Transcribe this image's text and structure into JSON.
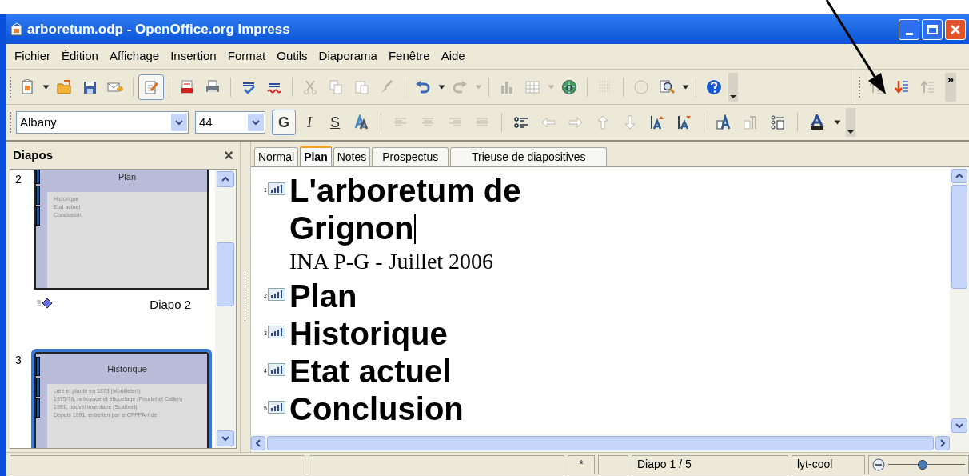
{
  "window": {
    "title": "arboretum.odp - OpenOffice.org Impress"
  },
  "menu": [
    "Fichier",
    "Édition",
    "Affichage",
    "Insertion",
    "Format",
    "Outils",
    "Diaporama",
    "Fenêtre",
    "Aide"
  ],
  "standard_toolbar": [
    {
      "kind": "new",
      "disabled": false
    },
    {
      "kind": "caret",
      "disabled": false
    },
    {
      "kind": "open",
      "disabled": false
    },
    {
      "kind": "save",
      "disabled": false
    },
    {
      "kind": "mail",
      "disabled": false
    },
    {
      "kind": "sep",
      "disabled": false
    },
    {
      "kind": "edit",
      "disabled": false
    },
    {
      "kind": "sep",
      "disabled": false
    },
    {
      "kind": "pdf",
      "disabled": false
    },
    {
      "kind": "print",
      "disabled": false
    },
    {
      "kind": "sep",
      "disabled": false
    },
    {
      "kind": "spell",
      "disabled": false
    },
    {
      "kind": "autospell",
      "disabled": false
    },
    {
      "kind": "sep",
      "disabled": false
    },
    {
      "kind": "cut",
      "disabled": true
    },
    {
      "kind": "copy",
      "disabled": true
    },
    {
      "kind": "paste",
      "disabled": true
    },
    {
      "kind": "brush",
      "disabled": true
    },
    {
      "kind": "sep",
      "disabled": false
    },
    {
      "kind": "undo",
      "disabled": false
    },
    {
      "kind": "caret",
      "disabled": false
    },
    {
      "kind": "redo",
      "disabled": true
    },
    {
      "kind": "caret",
      "disabled": true
    },
    {
      "kind": "sep",
      "disabled": false
    },
    {
      "kind": "chart",
      "disabled": true
    },
    {
      "kind": "table",
      "disabled": true
    },
    {
      "kind": "caret",
      "disabled": true
    },
    {
      "kind": "globe",
      "disabled": false
    },
    {
      "kind": "sep",
      "disabled": false
    },
    {
      "kind": "grid",
      "disabled": true
    },
    {
      "kind": "sep",
      "disabled": false
    },
    {
      "kind": "compass",
      "disabled": true
    },
    {
      "kind": "zoom",
      "disabled": false
    },
    {
      "kind": "caret",
      "disabled": false
    },
    {
      "kind": "sep",
      "disabled": false
    },
    {
      "kind": "help",
      "disabled": false
    }
  ],
  "outline_toolbar": {
    "buttons": [
      {
        "kind": "promote",
        "disabled": true
      },
      {
        "kind": "demote",
        "disabled": false
      },
      {
        "kind": "moveup",
        "disabled": true
      }
    ],
    "overflow": "»"
  },
  "format_toolbar": {
    "font": "Albany",
    "size": "44",
    "text_buttons": [
      {
        "kind": "bold",
        "text": "G",
        "selected": true
      },
      {
        "kind": "italic",
        "text": "I",
        "selected": false
      },
      {
        "kind": "underline",
        "text": "S",
        "selected": false
      }
    ],
    "icons": [
      {
        "kind": "shadow",
        "disabled": false
      },
      {
        "kind": "sep",
        "disabled": false
      },
      {
        "kind": "alignleft",
        "disabled": true
      },
      {
        "kind": "aligncenter",
        "disabled": true
      },
      {
        "kind": "alignright",
        "disabled": true
      },
      {
        "kind": "justify",
        "disabled": true
      },
      {
        "kind": "sep",
        "disabled": false
      },
      {
        "kind": "bullets",
        "disabled": false
      },
      {
        "kind": "left",
        "disabled": true
      },
      {
        "kind": "right",
        "disabled": true
      },
      {
        "kind": "up",
        "disabled": true
      },
      {
        "kind": "down",
        "disabled": true
      },
      {
        "kind": "spaceup",
        "disabled": false
      },
      {
        "kind": "spacedown",
        "disabled": false
      },
      {
        "kind": "sep",
        "disabled": false
      },
      {
        "kind": "character",
        "disabled": false
      },
      {
        "kind": "paragraph",
        "disabled": true
      },
      {
        "kind": "outline",
        "disabled": false
      },
      {
        "kind": "sep",
        "disabled": false
      },
      {
        "kind": "fontcolor",
        "disabled": false
      },
      {
        "kind": "caret",
        "disabled": false
      }
    ]
  },
  "slides_pane": {
    "title": "Diapos",
    "close": "×",
    "slides": [
      {
        "number": "2",
        "title": "Plan",
        "bullets": [
          "Historique",
          "Etat actuel",
          "Conclusion"
        ],
        "label": "Diapo 2",
        "transition": true,
        "selected": false
      },
      {
        "number": "3",
        "title": "Historique",
        "bullets": [
          "créé et planté en 1873 (Mouillefert)",
          "1975/76, nettoyage et étiquetage (Pourtet et Callen)",
          "1991, nouvel inventaire (Scalbert)",
          "Depuis 1991, entretien par le CFPPAH de"
        ],
        "transition": false,
        "selected": true
      }
    ]
  },
  "view_tabs": [
    {
      "label": "Normal",
      "selected": false
    },
    {
      "label": "Plan",
      "selected": true
    },
    {
      "label": "Notes",
      "selected": false
    },
    {
      "label": "Prospectus",
      "selected": false
    },
    {
      "label": "Trieuse de diapositives",
      "selected": false
    }
  ],
  "outline": [
    {
      "number": "1",
      "title": "L'arboretum de Grignon",
      "subtitle": "INA P-G - Juillet 2006",
      "cursor": true
    },
    {
      "number": "2",
      "title": "Plan",
      "cursor": false
    },
    {
      "number": "3",
      "title": "Historique",
      "cursor": false
    },
    {
      "number": "4",
      "title": "Etat actuel",
      "cursor": false
    },
    {
      "number": "5",
      "title": "Conclusion",
      "cursor": false
    }
  ],
  "status_bar": {
    "fields": [
      {
        "kind": "blank"
      },
      {
        "kind": "blank"
      },
      {
        "kind": "text",
        "text": "*"
      },
      {
        "kind": "blank"
      },
      {
        "kind": "text",
        "text": "Diapo 1 / 5"
      },
      {
        "kind": "text",
        "text": "lyt-cool"
      }
    ],
    "zoom": {
      "level": 0.45
    }
  }
}
